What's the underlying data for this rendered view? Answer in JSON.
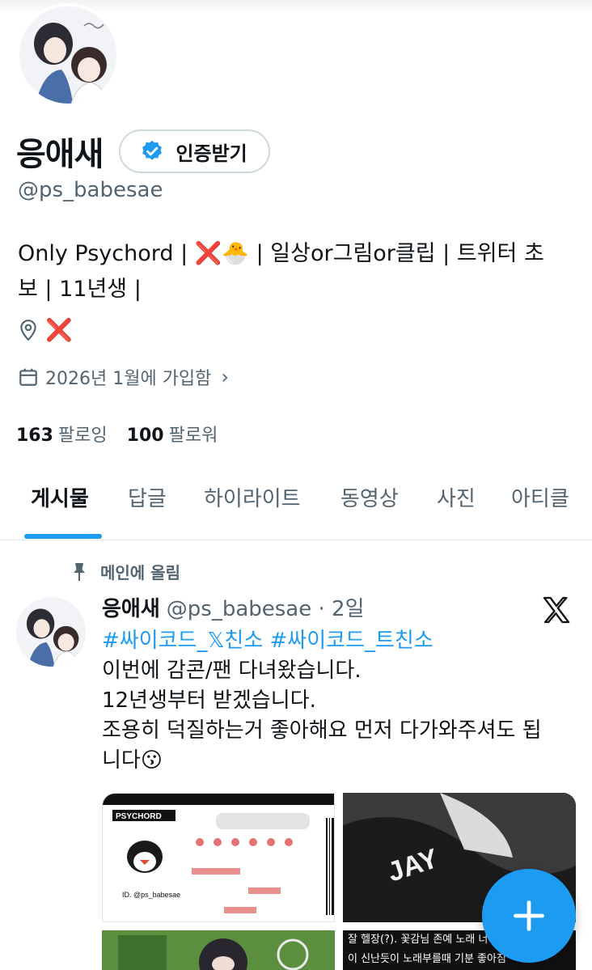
{
  "profile": {
    "display_name": "응애새",
    "verify_label": "인증받기",
    "handle": "@ps_babesae",
    "bio_line1_a": "Only Psychord | ",
    "bio_x": "❌",
    "bio_chick": "🐣",
    "bio_line1_b": " | 일상or그림or클립 | 트위터 초",
    "bio_line2": "보 | 11년생 |",
    "location_x": "❌",
    "joined": "2026년 1월에 가입함",
    "following_count": "163",
    "following_label": "팔로잉",
    "followers_count": "100",
    "followers_label": "팔로워"
  },
  "tabs": [
    "게시물",
    "답글",
    "하이라이트",
    "동영상",
    "사진",
    "아티클"
  ],
  "active_tab": "게시물",
  "pinned_label": "메인에 올림",
  "post": {
    "name": "응애새",
    "meta": "@ps_babesae · 2일",
    "hashtags": "#싸이코드_𝕏친소 #싸이코드_트친소",
    "line1": "이번에 감콘/팬 다녀왔습니다.",
    "line2": "12년생부터 받겠습니다.",
    "line3": "조용히 덕질하는거 좋아해요 먼저 다가와주셔도 됩",
    "line4": "니다",
    "line4_emoji": "😗"
  },
  "media": {
    "card_brand": "PSYCHORD",
    "card_id": "ID. @ps_babesae",
    "caption_line1": "잘 헬장(?). 꽃감님 존예 노래 너무",
    "caption_line2": "이 신난듯이 노래부를때 기분 좋아짐"
  },
  "colors": {
    "accent": "#1d9bf0",
    "secondary_text": "#536471",
    "primary_text": "#0f1419",
    "x_mark": "#e0242c"
  },
  "icons": {
    "verify": "verified-badge-icon",
    "location": "location-pin-icon",
    "calendar": "calendar-icon",
    "pin": "pin-icon",
    "x_logo": "x-logo-icon",
    "compose": "plus-icon"
  }
}
